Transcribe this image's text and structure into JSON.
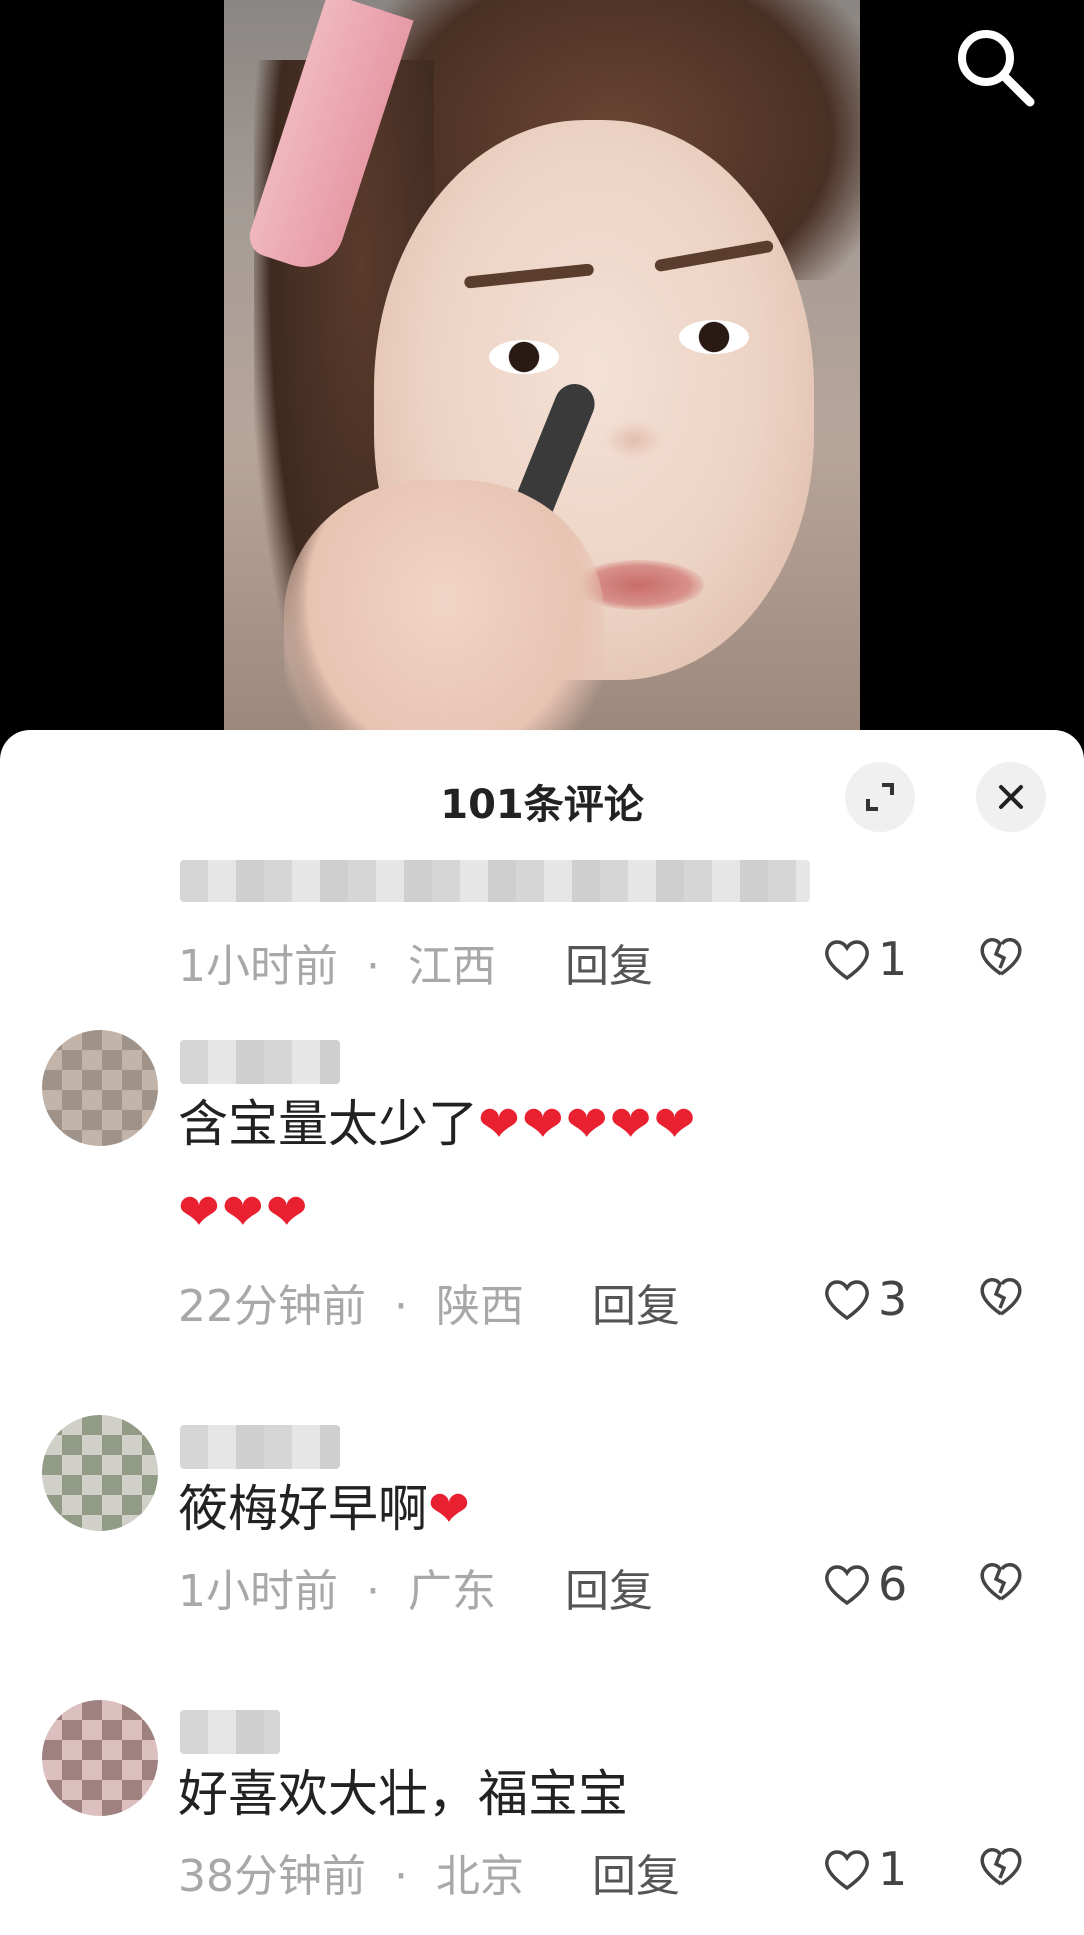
{
  "video": {
    "description_icon": "video-thumbnail"
  },
  "top_bar": {
    "search_icon": "search-icon"
  },
  "sheet": {
    "title": "101条评论",
    "expand_icon": "expand-icon",
    "close_icon": "close-icon"
  },
  "comments": [
    {
      "text": "",
      "time": "1小时前",
      "location": "江西",
      "reply": "回复",
      "likes": "1"
    },
    {
      "text": "含宝量太少了",
      "hearts": "❤❤❤❤❤",
      "hearts2": "❤❤❤",
      "time": "22分钟前",
      "location": "陕西",
      "reply": "回复",
      "likes": "3"
    },
    {
      "text": "筱梅好早啊",
      "hearts": "❤",
      "time": "1小时前",
      "location": "广东",
      "reply": "回复",
      "likes": "6"
    },
    {
      "text": "好喜欢大壮，福宝宝",
      "time": "38分钟前",
      "location": "北京",
      "reply": "回复",
      "likes": "1"
    }
  ],
  "separator": "·",
  "colors": {
    "heart": "#e8202f",
    "meta": "#a8a8a8",
    "sheet_bg": "#ffffff"
  }
}
